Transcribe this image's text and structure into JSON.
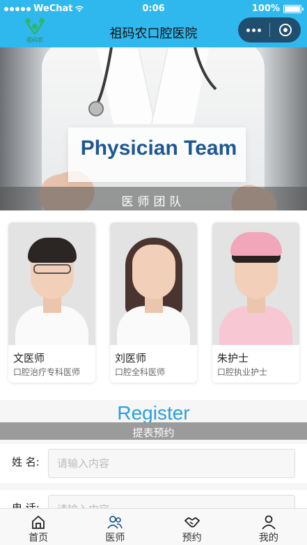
{
  "status_bar": {
    "carrier": "WeChat",
    "time": "0:06",
    "battery": "100%"
  },
  "nav": {
    "logo_text": "祖码农",
    "title": "祖码农口腔医院"
  },
  "banner": {
    "title": "Physician Team",
    "subtitle": "医师团队"
  },
  "doctors": [
    {
      "name": "文医师",
      "role": "口腔治疗专科医师"
    },
    {
      "name": "刘医师",
      "role": "口腔全科医师"
    },
    {
      "name": "朱护士",
      "role": "口腔执业护士"
    }
  ],
  "register": {
    "title": "Register",
    "subtitle": "提表预约",
    "fields": [
      {
        "label": "姓 名:",
        "placeholder": "请输入内容"
      },
      {
        "label": "电 话:",
        "placeholder": "请输入内容"
      }
    ]
  },
  "tabbar": {
    "items": [
      {
        "label": "首页",
        "icon": "home-icon"
      },
      {
        "label": "医师",
        "icon": "doctors-icon"
      },
      {
        "label": "预约",
        "icon": "handshake-icon"
      },
      {
        "label": "我的",
        "icon": "user-icon"
      }
    ]
  },
  "colors": {
    "nav_bg": "#2fb8ee",
    "accent_blue": "#2a9ee0",
    "banner_title": "#1d5794"
  }
}
